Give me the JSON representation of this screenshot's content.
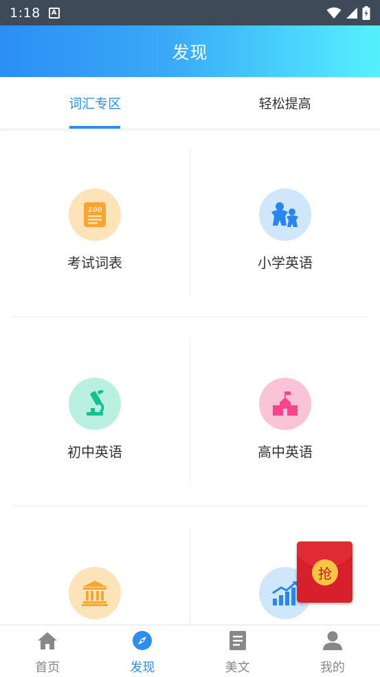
{
  "status_bar": {
    "time": "1:18",
    "notification_icon_letter": "A"
  },
  "header": {
    "title": "发现"
  },
  "tabs": [
    {
      "label": "词汇专区",
      "active": true
    },
    {
      "label": "轻松提高",
      "active": false
    }
  ],
  "categories": [
    {
      "label": "考试词表",
      "icon": "exam-sheet-icon",
      "bg_color": "#fde3b8",
      "icon_color": "#f7a635"
    },
    {
      "label": "小学英语",
      "icon": "kids-icon",
      "bg_color": "#cfe6fb",
      "icon_color": "#2b86ec"
    },
    {
      "label": "初中英语",
      "icon": "microscope-icon",
      "bg_color": "#b9f0e0",
      "icon_color": "#16c091"
    },
    {
      "label": "高中英语",
      "icon": "school-icon",
      "bg_color": "#fbc4d6",
      "icon_color": "#f6458a"
    },
    {
      "label": "",
      "icon": "museum-icon",
      "bg_color": "#fde3b8",
      "icon_color": "#f7a635"
    },
    {
      "label": "",
      "icon": "growth-chart-icon",
      "bg_color": "#cfe6fb",
      "icon_color": "#2b86ec"
    }
  ],
  "red_packet": {
    "text": "抢"
  },
  "bottom_nav": [
    {
      "label": "首页",
      "icon": "home-icon",
      "active": false
    },
    {
      "label": "发现",
      "icon": "compass-icon",
      "active": true
    },
    {
      "label": "美文",
      "icon": "article-icon",
      "active": false
    },
    {
      "label": "我的",
      "icon": "profile-icon",
      "active": false
    }
  ],
  "colors": {
    "accent": "#2d8ef0",
    "header_gradient_start": "#2b8ef5",
    "header_gradient_end": "#55f1ff",
    "status_bar": "#3f4a59"
  }
}
